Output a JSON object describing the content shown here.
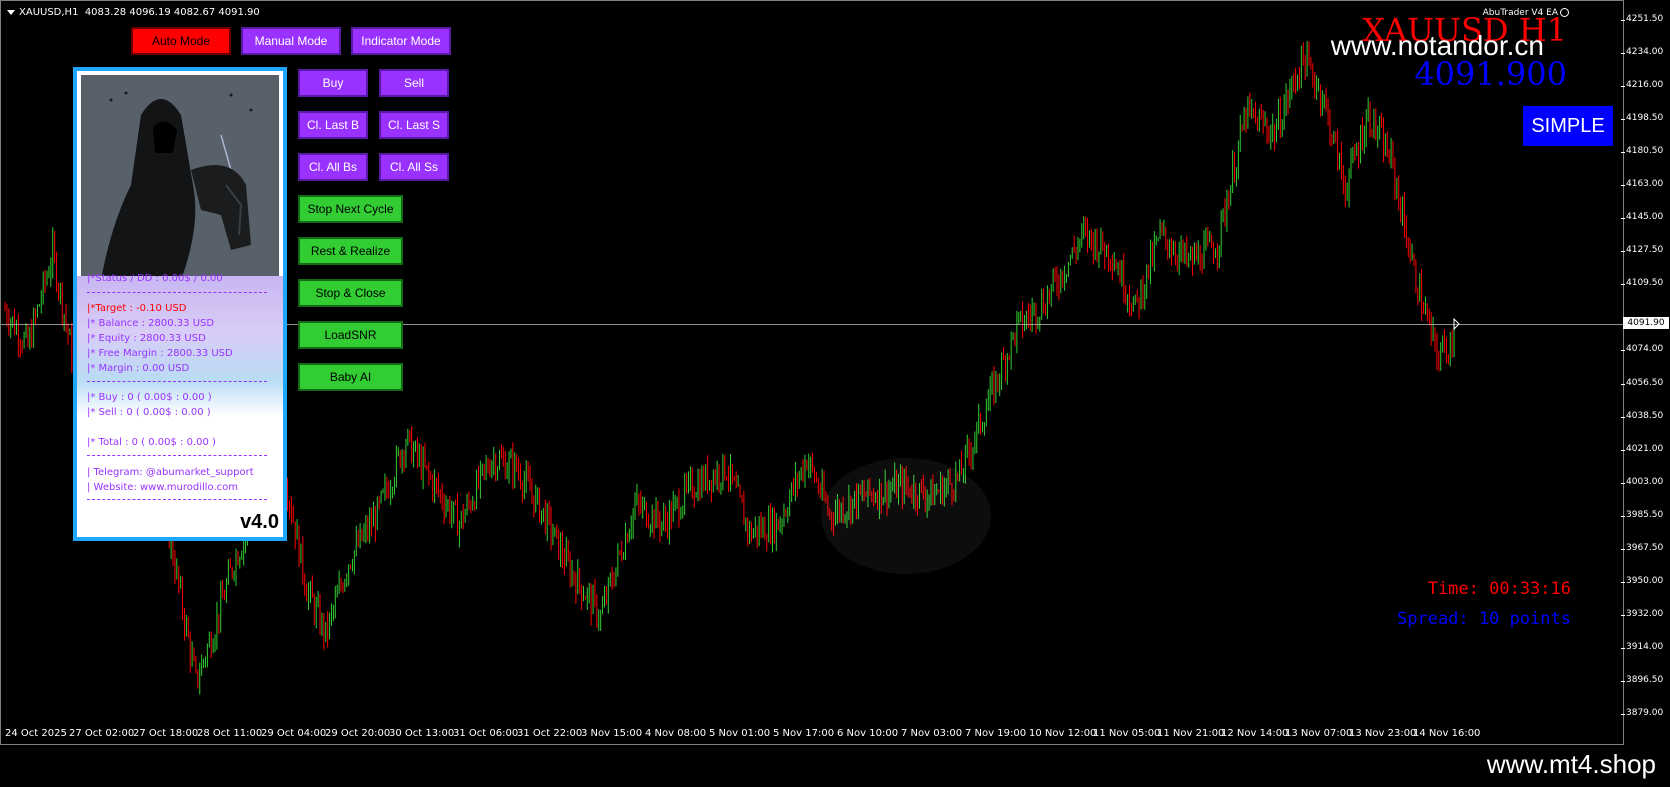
{
  "chart_header": {
    "symbol_info": "XAUUSD,H1",
    "ohlc": "4083.28 4096.19 4082.67 4091.90",
    "ea_label": "AbuTrader V4 EA"
  },
  "overlay": {
    "symbol_title": "XAUUSD H1",
    "site_watermark": "www.notandor.cn",
    "current_price": "4091.900",
    "mode_badge": "SIMPLE",
    "time_text": "Time: 00:33:16",
    "spread_text": "Spread: 10 points",
    "footer_watermark": "www.mt4.shop"
  },
  "mode_buttons": [
    "Auto Mode",
    "Manual Mode",
    "Indicator Mode"
  ],
  "trade_buttons": [
    "Buy",
    "Sell",
    "Cl. Last B",
    "Cl. Last S",
    "Cl. All Bs",
    "Cl. All Ss"
  ],
  "action_buttons": [
    "Stop Next Cycle",
    "Rest & Realize",
    "Stop & Close",
    "LoadSNR",
    "Baby AI"
  ],
  "panel": {
    "status": "|*Status / DD     : 0.00$ / 0.00",
    "target": "|*Target     : -0.10  USD",
    "balance": "|* Balance      : 2800.33  USD",
    "equity": "|* Equity      : 2800.33  USD",
    "free_margin": "|* Free Margin  : 2800.33  USD",
    "margin": "|* Margin       : 0.00  USD",
    "buy": "|* Buy   : 0 ( 0.00$ : 0.00 )",
    "sell": "|* Sell    : 0 ( 0.00$ : 0.00 )",
    "total": "|* Total  : 0 ( 0.00$ : 0.00 )",
    "telegram": "|  Telegram: @abumarket_support",
    "website": "|  Website: www.murodillo.com",
    "version": "v4.0"
  },
  "price_axis": {
    "ticks": [
      "4251.50",
      "4234.00",
      "4216.00",
      "4198.50",
      "4180.50",
      "4163.00",
      "4145.00",
      "4127.50",
      "4109.50",
      "4091.90",
      "4074.00",
      "4056.50",
      "4038.50",
      "4021.00",
      "4003.00",
      "3985.50",
      "3967.50",
      "3950.00",
      "3932.00",
      "3914.00",
      "3896.50",
      "3879.00"
    ],
    "current_label": "4091.90"
  },
  "time_axis": {
    "labels": [
      "24 Oct 2025",
      "27 Oct 02:00",
      "27 Oct 18:00",
      "28 Oct 11:00",
      "29 Oct 04:00",
      "29 Oct 20:00",
      "30 Oct 13:00",
      "31 Oct 06:00",
      "31 Oct 22:00",
      "3 Nov 15:00",
      "4 Nov 08:00",
      "5 Nov 01:00",
      "5 Nov 17:00",
      "6 Nov 10:00",
      "7 Nov 03:00",
      "7 Nov 19:00",
      "10 Nov 12:00",
      "11 Nov 05:00",
      "11 Nov 21:00",
      "12 Nov 14:00",
      "13 Nov 07:00",
      "13 Nov 23:00",
      "14 Nov 16:00"
    ]
  },
  "chart_data": {
    "type": "candlestick",
    "symbol": "XAUUSD",
    "timeframe": "H1",
    "ylim": [
      3879.0,
      4251.5
    ],
    "current_price": 4091.9,
    "anchors": [
      [
        0,
        4100
      ],
      [
        12,
        4080
      ],
      [
        25,
        4130
      ],
      [
        38,
        4060
      ],
      [
        55,
        4070
      ],
      [
        70,
        4020
      ],
      [
        85,
        3985
      ],
      [
        100,
        3900
      ],
      [
        110,
        3930
      ],
      [
        120,
        3965
      ],
      [
        135,
        4000
      ],
      [
        145,
        4020
      ],
      [
        158,
        3950
      ],
      [
        168,
        3925
      ],
      [
        180,
        3965
      ],
      [
        195,
        3990
      ],
      [
        210,
        4030
      ],
      [
        222,
        4010
      ],
      [
        238,
        3985
      ],
      [
        255,
        4020
      ],
      [
        268,
        4015
      ],
      [
        282,
        3990
      ],
      [
        296,
        3960
      ],
      [
        312,
        3935
      ],
      [
        330,
        3995
      ],
      [
        345,
        3985
      ],
      [
        360,
        4005
      ],
      [
        378,
        4015
      ],
      [
        390,
        3980
      ],
      [
        405,
        3985
      ],
      [
        420,
        4020
      ],
      [
        432,
        3990
      ],
      [
        450,
        4000
      ],
      [
        470,
        4005
      ],
      [
        485,
        4000
      ],
      [
        500,
        4010
      ],
      [
        515,
        4050
      ],
      [
        530,
        4090
      ],
      [
        545,
        4105
      ],
      [
        565,
        4140
      ],
      [
        580,
        4130
      ],
      [
        592,
        4100
      ],
      [
        605,
        4140
      ],
      [
        620,
        4125
      ],
      [
        635,
        4135
      ],
      [
        650,
        4205
      ],
      [
        665,
        4195
      ],
      [
        680,
        4235
      ],
      [
        690,
        4215
      ],
      [
        702,
        4165
      ],
      [
        714,
        4205
      ],
      [
        726,
        4180
      ],
      [
        738,
        4120
      ],
      [
        750,
        4075
      ],
      [
        760,
        4085
      ]
    ]
  },
  "colors": {
    "bull": "#32cd32",
    "bear": "#ff0000",
    "background": "#000000",
    "accent_blue": "#0000ff",
    "panel_border": "#1ea7ff"
  }
}
